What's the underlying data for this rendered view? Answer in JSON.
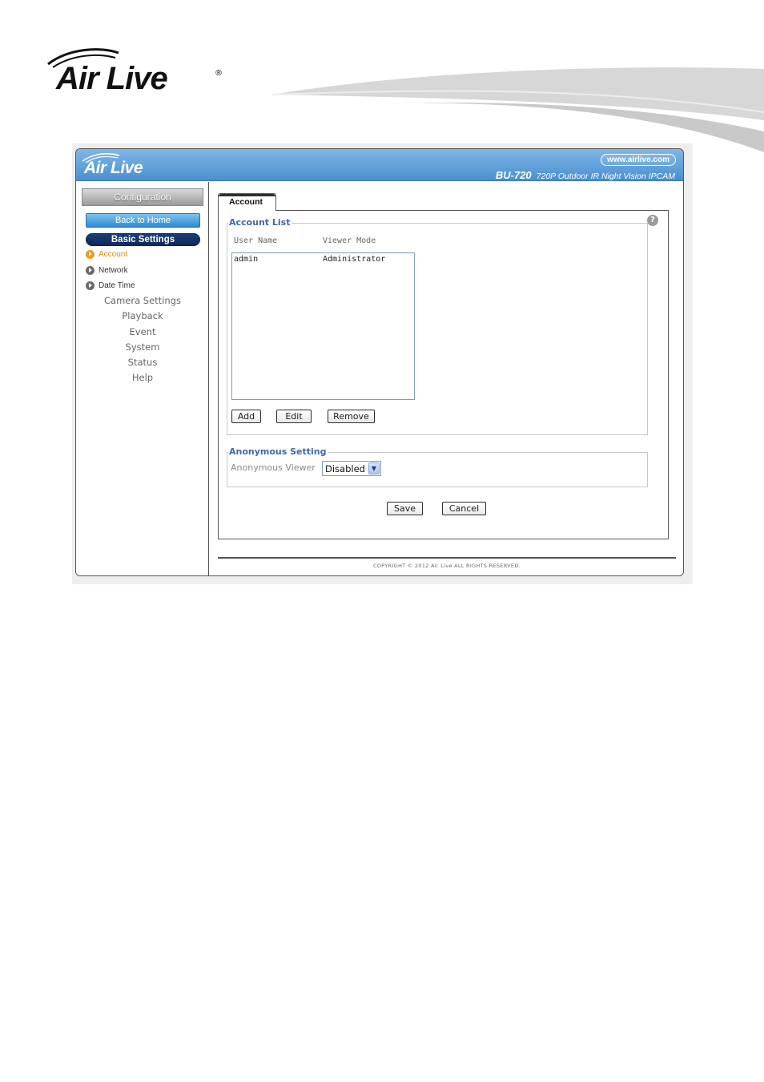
{
  "document": {
    "logo_text": "Air Live",
    "logo_reg": "®"
  },
  "app": {
    "banner": {
      "logo_text": "Air Live",
      "url": "www.airlive.com",
      "model_name": "BU-720",
      "model_desc": "720P Outdoor IR Night Vision IPCAM"
    },
    "sidebar": {
      "configuration_label": "Configuration",
      "back_home_label": "Back to Home",
      "basic_settings_label": "Basic Settings",
      "sub_items": [
        {
          "label": "Account",
          "active": true
        },
        {
          "label": "Network",
          "active": false
        },
        {
          "label": "Date Time",
          "active": false
        }
      ],
      "menu_items": [
        "Camera Settings",
        "Playback",
        "Event",
        "System",
        "Status",
        "Help"
      ]
    },
    "tab_label": "Account",
    "help_icon_glyph": "?",
    "account_list": {
      "legend": "Account List",
      "columns": [
        "User Name",
        "Viewer Mode"
      ],
      "rows": [
        {
          "user": "admin",
          "mode": "Administrator"
        }
      ],
      "buttons": {
        "add": "Add",
        "edit": "Edit",
        "remove": "Remove"
      }
    },
    "anonymous": {
      "legend": "Anonymous Setting",
      "label": "Anonymous Viewer",
      "selected": "Disabled"
    },
    "actions": {
      "save": "Save",
      "cancel": "Cancel"
    },
    "copyright": "COPYRIGHT © 2012 Air Live ALL RIGHTS RESERVED."
  },
  "colors": {
    "banner_blue": "#4b8fd0",
    "legend_blue": "#3f68a8",
    "active_orange": "#e88a0c",
    "basic_settings_navy": "#102a56"
  }
}
